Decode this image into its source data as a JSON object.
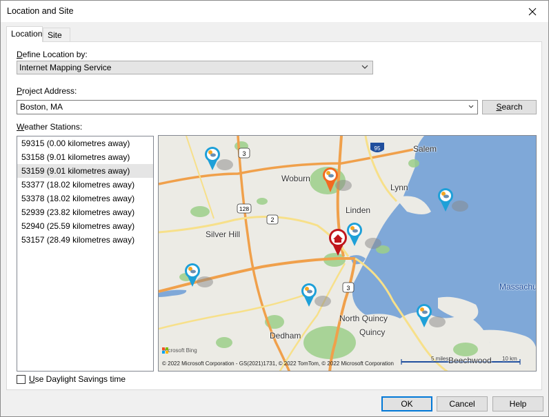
{
  "window": {
    "title": "Location and Site"
  },
  "tabs": [
    {
      "label": "Location"
    },
    {
      "label": "Site"
    }
  ],
  "define_location": {
    "label_key": "D",
    "label_rest": "efine Location by:",
    "value": "Internet Mapping Service"
  },
  "project_address": {
    "label_key": "P",
    "label_rest": "roject Address:",
    "value": "Boston, MA",
    "search_label_key": "S",
    "search_label_rest": "earch"
  },
  "weather_stations": {
    "label_key": "W",
    "label_rest": "eather Stations:",
    "selected_index": 2,
    "items": [
      "59315 (0.00 kilometres away)",
      "53158 (9.01 kilometres away)",
      "53159 (9.01 kilometres away)",
      "53377 (18.02 kilometres away)",
      "53378 (18.02 kilometres away)",
      "52939 (23.82 kilometres away)",
      "52940 (25.59 kilometres away)",
      "53157 (28.49 kilometres away)"
    ]
  },
  "map": {
    "places": [
      "Salem",
      "Woburn",
      "Lynn",
      "Linden",
      "Silver Hill",
      "North Quincy",
      "Quincy",
      "Dedham",
      "Massachu",
      "Beechwood"
    ],
    "routes": [
      "3",
      "95",
      "128",
      "2",
      "3"
    ],
    "attribution": "© 2022 Microsoft Corporation - GS(2021)1731, © 2022 TomTom, © 2022 Microsoft Corporation",
    "brand": "Microsoft Bing",
    "scale_miles": "5 miles",
    "scale_km": "10 km",
    "colors": {
      "water": "#7fa8d8",
      "land": "#ecebe5",
      "park": "#9ccf8a",
      "highway": "#f0a04b",
      "road": "#f7e08a",
      "station_pin": "#1ea0d8",
      "site_pin": "#c0151b",
      "selected_pin": "#f26a21"
    }
  },
  "daylight": {
    "label_key": "U",
    "label_rest": "se Daylight Savings time",
    "checked": false
  },
  "buttons": {
    "ok": "OK",
    "cancel": "Cancel",
    "help": "Help"
  }
}
